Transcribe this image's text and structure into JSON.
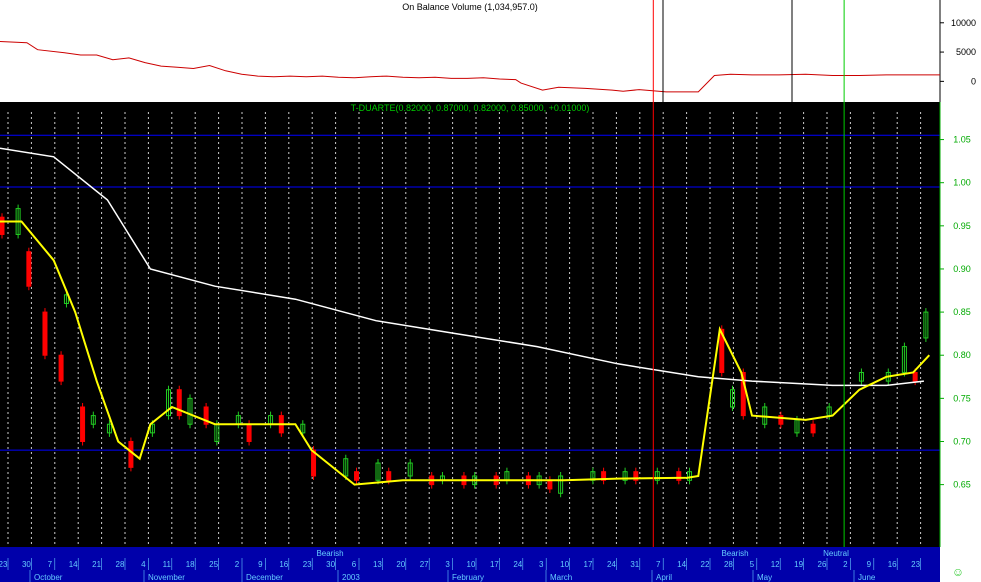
{
  "colors": {
    "main_bg": "#000000",
    "top_bg": "#ffffff",
    "obv_line": "#cc0000",
    "ma_long": "#ffffff",
    "ma_short": "#ffff00",
    "up_bar": "#22cc22",
    "down_bar": "#ff0000",
    "grid_v": "#dddddd",
    "grid_h": "#0000ff",
    "axis_text": "#00aa00",
    "band_bg": "#0000aa",
    "band_text": "#66ccff",
    "smiley": "#33cc33"
  },
  "chart_data": [
    {
      "type": "line",
      "name": "obv-panel",
      "title": "On Balance Volume (1,034,957.0)",
      "y_ticks": [
        "10000",
        "5000",
        "0"
      ],
      "ylim": [
        -2500,
        11500
      ],
      "x_index_range": [
        0,
        175
      ],
      "series": [
        {
          "name": "",
          "points": [
            [
              0,
              6800
            ],
            [
              5,
              6600
            ],
            [
              7,
              5400
            ],
            [
              12,
              4900
            ],
            [
              15,
              4500
            ],
            [
              18,
              4500
            ],
            [
              21,
              3700
            ],
            [
              24,
              4000
            ],
            [
              27,
              3200
            ],
            [
              30,
              2600
            ],
            [
              33,
              2400
            ],
            [
              36,
              2200
            ],
            [
              39,
              2700
            ],
            [
              42,
              1800
            ],
            [
              45,
              1200
            ],
            [
              48,
              900
            ],
            [
              51,
              800
            ],
            [
              54,
              900
            ],
            [
              57,
              800
            ],
            [
              60,
              900
            ],
            [
              63,
              700
            ],
            [
              66,
              600
            ],
            [
              69,
              800
            ],
            [
              72,
              900
            ],
            [
              75,
              700
            ],
            [
              78,
              600
            ],
            [
              81,
              700
            ],
            [
              84,
              500
            ],
            [
              87,
              500
            ],
            [
              90,
              600
            ],
            [
              93,
              400
            ],
            [
              96,
              300
            ],
            [
              97,
              -300
            ],
            [
              101,
              -1500
            ],
            [
              104,
              -1000
            ],
            [
              109,
              -1200
            ],
            [
              114,
              -1500
            ],
            [
              116,
              -1700
            ],
            [
              119,
              -1400
            ],
            [
              124,
              -1800
            ],
            [
              130,
              -1800
            ],
            [
              133,
              1000
            ],
            [
              136,
              1200
            ],
            [
              140,
              1100
            ],
            [
              145,
              1100
            ],
            [
              150,
              1200
            ],
            [
              155,
              1000
            ],
            [
              160,
              1000
            ],
            [
              165,
              1100
            ],
            [
              170,
              1100
            ],
            [
              175,
              1100
            ],
            [
              180,
              1100
            ],
            [
              186,
              1100
            ],
            [
              190,
              1100
            ],
            [
              192,
              1100
            ],
            [
              200,
              1100
            ],
            [
              210,
              1100
            ],
            [
              218,
              1100
            ],
            [
              225,
              1100
            ],
            [
              232,
              1100
            ],
            [
              240,
              1100
            ],
            [
              250,
              1100
            ]
          ]
        }
      ],
      "series_note": ""
    },
    {
      "type": "candlestick",
      "name": "price-panel",
      "title": "T-DUARTE(0.82000, 0.87000, 0.82000, 0.85000, +0.01000)",
      "y_ticks": [
        "1.05",
        "1.00",
        "0.95",
        "0.90",
        "0.85",
        "0.80",
        "0.75",
        "0.70",
        "0.65"
      ],
      "ylim": [
        0.58,
        1.075
      ],
      "ma_long": [
        [
          0,
          1.04
        ],
        [
          10,
          1.03
        ],
        [
          20,
          0.98
        ],
        [
          28,
          0.9
        ],
        [
          40,
          0.88
        ],
        [
          55,
          0.865
        ],
        [
          70,
          0.84
        ],
        [
          85,
          0.825
        ],
        [
          100,
          0.81
        ],
        [
          115,
          0.79
        ],
        [
          130,
          0.775
        ],
        [
          140,
          0.77
        ],
        [
          155,
          0.765
        ],
        [
          165,
          0.765
        ],
        [
          172,
          0.77
        ]
      ],
      "ma_short": [
        [
          0,
          0.955
        ],
        [
          4,
          0.955
        ],
        [
          10,
          0.91
        ],
        [
          14,
          0.85
        ],
        [
          18,
          0.77
        ],
        [
          22,
          0.7
        ],
        [
          26,
          0.68
        ],
        [
          28,
          0.72
        ],
        [
          32,
          0.74
        ],
        [
          40,
          0.72
        ],
        [
          55,
          0.72
        ],
        [
          58,
          0.69
        ],
        [
          62,
          0.67
        ],
        [
          66,
          0.65
        ],
        [
          75,
          0.655
        ],
        [
          90,
          0.655
        ],
        [
          100,
          0.655
        ],
        [
          105,
          0.655
        ],
        [
          115,
          0.657
        ],
        [
          128,
          0.658
        ],
        [
          130,
          0.66
        ],
        [
          134,
          0.83
        ],
        [
          138,
          0.78
        ],
        [
          140,
          0.73
        ],
        [
          150,
          0.725
        ],
        [
          155,
          0.73
        ],
        [
          160,
          0.76
        ],
        [
          165,
          0.775
        ],
        [
          170,
          0.78
        ],
        [
          173,
          0.8
        ]
      ],
      "candles_up": [
        [
          3,
          0.94,
          0.97
        ],
        [
          12,
          0.86,
          0.87
        ],
        [
          17,
          0.73,
          0.72
        ],
        [
          20,
          0.72,
          0.71
        ],
        [
          28,
          0.72,
          0.71
        ],
        [
          31,
          0.73,
          0.76
        ],
        [
          35,
          0.72,
          0.75
        ],
        [
          40,
          0.7,
          0.72
        ],
        [
          44,
          0.72,
          0.73
        ],
        [
          50,
          0.72,
          0.73
        ],
        [
          56,
          0.71,
          0.72
        ],
        [
          64,
          0.66,
          0.68
        ],
        [
          70,
          0.655,
          0.675
        ],
        [
          76,
          0.66,
          0.675
        ],
        [
          82,
          0.655,
          0.66
        ],
        [
          88,
          0.65,
          0.66
        ],
        [
          94,
          0.655,
          0.665
        ],
        [
          100,
          0.65,
          0.66
        ],
        [
          104,
          0.64,
          0.66
        ],
        [
          110,
          0.655,
          0.665
        ],
        [
          116,
          0.655,
          0.665
        ],
        [
          122,
          0.655,
          0.665
        ],
        [
          128,
          0.655,
          0.665
        ],
        [
          136,
          0.74,
          0.76
        ],
        [
          142,
          0.72,
          0.74
        ],
        [
          148,
          0.71,
          0.725
        ],
        [
          154,
          0.73,
          0.74
        ],
        [
          160,
          0.77,
          0.78
        ],
        [
          165,
          0.77,
          0.78
        ],
        [
          168,
          0.78,
          0.81
        ],
        [
          172,
          0.82,
          0.85
        ]
      ],
      "candles_down": [
        [
          0,
          0.96,
          0.94
        ],
        [
          5,
          0.92,
          0.88
        ],
        [
          8,
          0.85,
          0.8
        ],
        [
          11,
          0.8,
          0.77
        ],
        [
          15,
          0.74,
          0.7
        ],
        [
          24,
          0.7,
          0.67
        ],
        [
          33,
          0.76,
          0.73
        ],
        [
          38,
          0.74,
          0.72
        ],
        [
          46,
          0.72,
          0.7
        ],
        [
          52,
          0.73,
          0.71
        ],
        [
          58,
          0.69,
          0.66
        ],
        [
          66,
          0.665,
          0.655
        ],
        [
          72,
          0.665,
          0.655
        ],
        [
          80,
          0.66,
          0.65
        ],
        [
          86,
          0.66,
          0.65
        ],
        [
          92,
          0.66,
          0.65
        ],
        [
          98,
          0.66,
          0.65
        ],
        [
          102,
          0.655,
          0.645
        ],
        [
          112,
          0.665,
          0.655
        ],
        [
          118,
          0.665,
          0.655
        ],
        [
          126,
          0.665,
          0.655
        ],
        [
          134,
          0.83,
          0.78
        ],
        [
          138,
          0.78,
          0.73
        ],
        [
          145,
          0.73,
          0.72
        ],
        [
          151,
          0.72,
          0.71
        ],
        [
          170,
          0.78,
          0.77
        ]
      ],
      "vlines_black": [
        0.664,
        0.808
      ],
      "vline_red": 0.695,
      "vline_green": 0.898
    }
  ],
  "bottom_axis": {
    "signals": [
      "Bearish",
      "Bearish",
      "Neutral"
    ],
    "days": [
      "23",
      "30",
      "7",
      "14",
      "21",
      "28",
      "4",
      "11",
      "18",
      "25",
      "2",
      "9",
      "16",
      "23",
      "30",
      "6",
      "13",
      "20",
      "27",
      "3",
      "10",
      "17",
      "24",
      "3",
      "10",
      "17",
      "24",
      "31",
      "7",
      "14",
      "22",
      "28",
      "5",
      "12",
      "19",
      "26",
      "2",
      "9",
      "16",
      "23"
    ],
    "months": [
      "October",
      "November",
      "December",
      "2003",
      "February",
      "March",
      "April",
      "May",
      "June"
    ]
  }
}
